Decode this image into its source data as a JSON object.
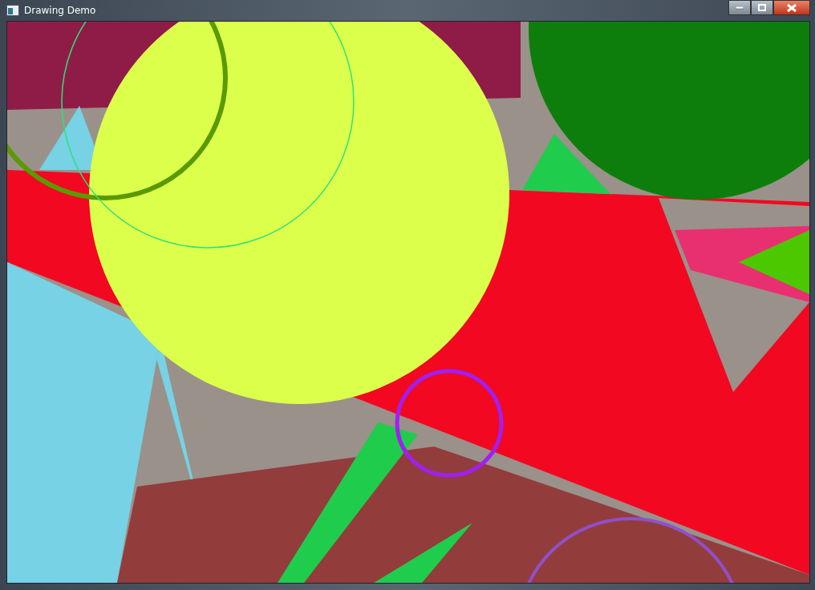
{
  "window": {
    "title": "Drawing Demo"
  }
}
